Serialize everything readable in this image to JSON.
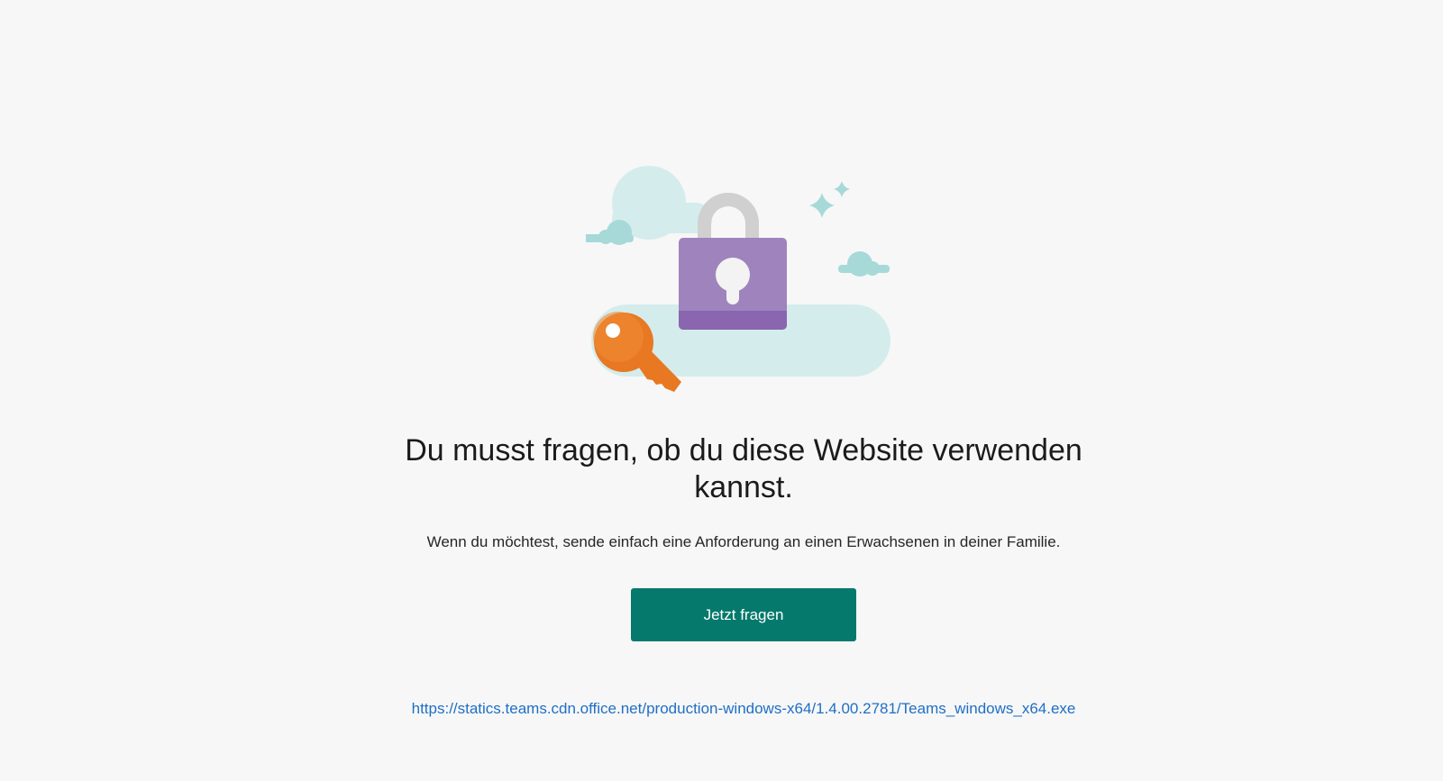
{
  "blocked_page": {
    "headline": "Du musst fragen, ob du diese Website verwenden kannst.",
    "subtext": "Wenn du möchtest, sende einfach eine Anforderung an einen Erwachsenen in deiner Familie.",
    "ask_button_label": "Jetzt fragen",
    "requested_url": "https://statics.teams.cdn.office.net/production-windows-x64/1.4.00.2781/Teams_windows_x64.exe"
  },
  "illustration": {
    "icons": [
      "cloud-icon",
      "padlock-icon",
      "key-icon",
      "sparkle-icon"
    ]
  },
  "colors": {
    "background": "#f7f7f7",
    "button": "#05796b",
    "link": "#1f6fc5",
    "padlock_body": "#9f83bd",
    "padlock_bottom": "#8a65b0",
    "key": "#e87822",
    "cloud_light": "#d5ecec",
    "cloud_teal": "#a7d9d9"
  }
}
